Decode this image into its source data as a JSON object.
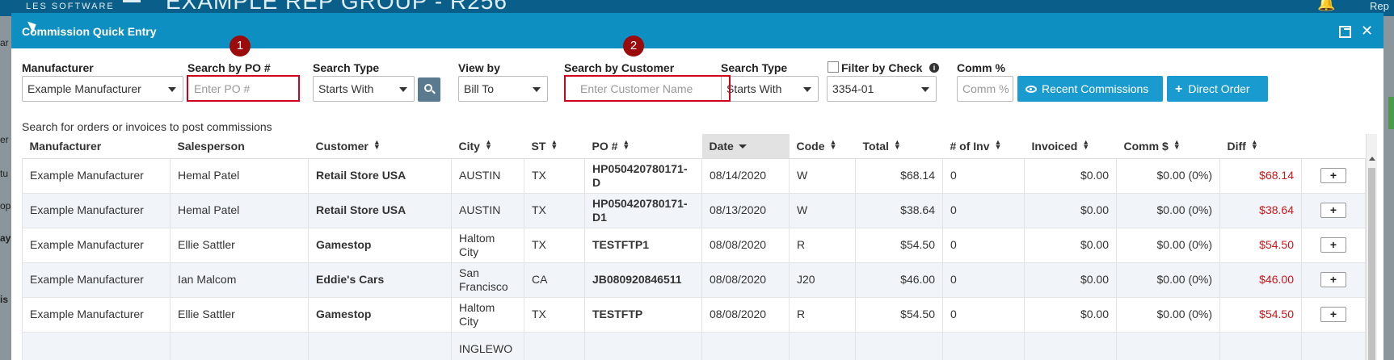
{
  "app": {
    "logo_sub": "LES SOFTWARE",
    "title": "EXAMPLE REP GROUP - R256",
    "right_text": "Rep",
    "left_fragments": [
      "ar",
      "er",
      "tu",
      "op",
      "ay",
      "is"
    ]
  },
  "modal": {
    "title": "Commission Quick Entry"
  },
  "filters": {
    "manufacturer": {
      "label": "Manufacturer",
      "value": "Example Manufacturer"
    },
    "search_po": {
      "label": "Search by PO #",
      "placeholder": "Enter PO #"
    },
    "search_type_1": {
      "label": "Search Type",
      "value": "Starts With"
    },
    "view_by": {
      "label": "View by",
      "value": "Bill To"
    },
    "search_customer": {
      "label": "Search by Customer",
      "placeholder": "Enter Customer Name"
    },
    "search_type_2": {
      "label": "Search Type",
      "value": "Starts With"
    },
    "filter_by_check": {
      "label": "Filter by Check",
      "value": "3354-01",
      "checked": false
    },
    "comm_pct": {
      "label": "Comm %",
      "placeholder": "Comm %"
    }
  },
  "buttons": {
    "recent_commissions": "Recent Commissions",
    "direct_order": "Direct Order"
  },
  "annotations": [
    "1",
    "2"
  ],
  "helper_text": "Search for orders or invoices to post commissions",
  "table": {
    "columns": [
      "Manufacturer",
      "Salesperson",
      "Customer",
      "City",
      "ST",
      "PO #",
      "Date",
      "Code",
      "Total",
      "# of Inv",
      "Invoiced",
      "Comm $",
      "Diff"
    ],
    "rows": [
      {
        "manufacturer": "Example Manufacturer",
        "salesperson": "Hemal Patel",
        "customer": "Retail Store USA",
        "city": "AUSTIN",
        "st": "TX",
        "po": "HP050420780171-D",
        "date": "08/14/2020",
        "code": "W",
        "total": "$68.14",
        "num_inv": "0",
        "invoiced": "$0.00",
        "comm": "$0.00 (0%)",
        "diff": "$68.14",
        "add": "+"
      },
      {
        "manufacturer": "Example Manufacturer",
        "salesperson": "Hemal Patel",
        "customer": "Retail Store USA",
        "city": "AUSTIN",
        "st": "TX",
        "po": "HP050420780171-D1",
        "date": "08/13/2020",
        "code": "W",
        "total": "$38.64",
        "num_inv": "0",
        "invoiced": "$0.00",
        "comm": "$0.00 (0%)",
        "diff": "$38.64",
        "add": "+"
      },
      {
        "manufacturer": "Example Manufacturer",
        "salesperson": "Ellie Sattler",
        "customer": "Gamestop",
        "city": "Haltom City",
        "st": "TX",
        "po": "TESTFTP1",
        "date": "08/08/2020",
        "code": "R",
        "total": "$54.50",
        "num_inv": "0",
        "invoiced": "$0.00",
        "comm": "$0.00 (0%)",
        "diff": "$54.50",
        "add": "+"
      },
      {
        "manufacturer": "Example Manufacturer",
        "salesperson": "Ian Malcom",
        "customer": "Eddie's Cars",
        "city": "San Francisco",
        "st": "CA",
        "po": "JB080920846511",
        "date": "08/08/2020",
        "code": "J20",
        "total": "$46.00",
        "num_inv": "0",
        "invoiced": "$0.00",
        "comm": "$0.00 (0%)",
        "diff": "$46.00",
        "add": "+"
      },
      {
        "manufacturer": "Example Manufacturer",
        "salesperson": "Ellie Sattler",
        "customer": "Gamestop",
        "city": "Haltom City",
        "st": "TX",
        "po": "TESTFTP",
        "date": "08/08/2020",
        "code": "R",
        "total": "$54.50",
        "num_inv": "0",
        "invoiced": "$0.00",
        "comm": "$0.00 (0%)",
        "diff": "$54.50",
        "add": "+"
      },
      {
        "manufacturer": "",
        "salesperson": "",
        "customer": "",
        "city": "INGLEWO",
        "st": "",
        "po": "",
        "date": "",
        "code": "",
        "total": "",
        "num_inv": "",
        "invoiced": "",
        "comm": "",
        "diff": "",
        "add": ""
      }
    ]
  },
  "colors": {
    "header": "#0e8fc2",
    "accent_button": "#1a9bd0",
    "highlight": "#d0021b",
    "diff_text": "#c9161b"
  }
}
